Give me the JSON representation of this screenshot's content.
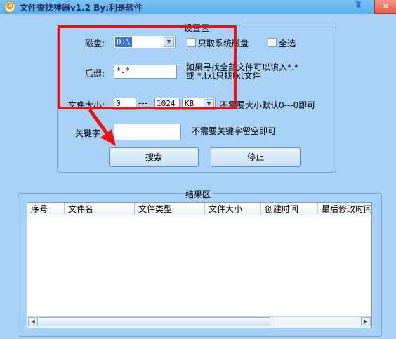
{
  "window": {
    "title": "文件查找神器v1.2  By:利是软件",
    "close_label": "✕"
  },
  "settings": {
    "group_title": "设置区",
    "drive_label": "磁盘:",
    "drive_value": "D:\\",
    "system_drive_only": "只取系统磁盘",
    "select_all": "全选",
    "suffix_label": "后缀:",
    "suffix_value": "*.*",
    "suffix_hint_1": "如果寻找全部文件可以填入*.*",
    "suffix_hint_2": "或 *.txt只找txt文件",
    "size_label": "文件大小:",
    "size_min": "0",
    "size_sep": "---",
    "size_max": "1024",
    "size_unit": "KB",
    "size_hint": "不需要大小默认0---0即可",
    "keyword_label": "关键字",
    "keyword_value": "",
    "keyword_hint": "不需要关键字留空即可",
    "search_button": "搜索",
    "stop_button": "停止"
  },
  "results": {
    "group_title": "结果区",
    "columns": [
      "序号",
      "文件名",
      "文件类型",
      "文件大小",
      "创建时间",
      "最后修改时间"
    ],
    "rows": []
  },
  "annotation": {
    "highlight_color": "#e81010"
  }
}
